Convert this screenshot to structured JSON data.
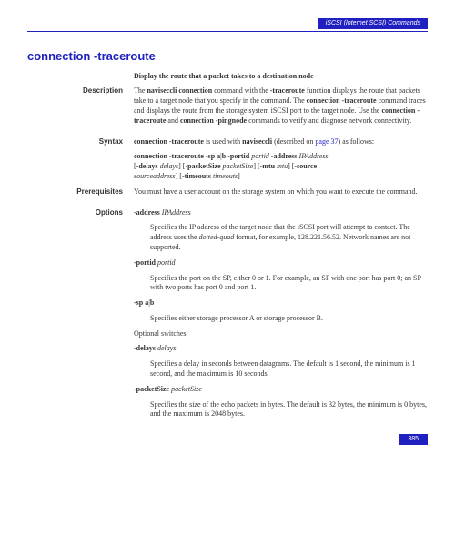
{
  "header": {
    "title": "iSCSI (Internet SCSI) Commands"
  },
  "section_title": "connection  -traceroute",
  "subtitle": "Display the route that a packet takes to a destination node",
  "description": {
    "label": "Description",
    "p1a": "The ",
    "p1b": "naviseccli connection",
    "p1c": " command with the ",
    "p1d": "-traceroute",
    "p1e": " function displays the route that packets take to a target node that you specify in the command. The ",
    "p1f": "connection -traceroute",
    "p1g": " command traces and displays the route from the storage system iSCSI port to the target node. Use the ",
    "p1h": "connection -traceroute",
    "p1i": " and ",
    "p1j": "connection -pingnode",
    "p1k": " commands to verify and diagnose network connectivity."
  },
  "syntax": {
    "label": "Syntax",
    "l1a": "connection  -traceroute",
    "l1b": " is used with ",
    "l1c": "naviseccli",
    "l1d": " (described on ",
    "l1e": "page 37",
    "l1f": ") as follows:",
    "l2a": "connection  -traceroute -sp a",
    "l2b": "|",
    "l2c": "b -portid",
    "l2d": " portid ",
    "l2e": "-address",
    "l2f": " IPAddress",
    "l3a": "[",
    "l3b": "-delays",
    "l3c": " delays",
    "l3d": "] [",
    "l3e": "-packetSize",
    "l3f": " packetSize",
    "l3g": "] [",
    "l3h": "-mtu",
    "l3i": " mtu",
    "l3j": "] [",
    "l3k": "-source",
    "l4a": "sourceaddress",
    "l4b": "] [",
    "l4c": "-timeouts",
    "l4d": " timeouts",
    "l4e": "]"
  },
  "prerequisites": {
    "label": "Prerequisites",
    "text": "You must have a user account on the storage system on which you want to execute the command."
  },
  "options": {
    "label": "Options",
    "opt1": {
      "flag": "-address",
      "arg": " IPAddress",
      "desc_a": "Specifies the IP address of the target node that the iSCSI port will attempt to contact. The address uses the ",
      "desc_b": "dotted-quad",
      "desc_c": " format, for example, 128.221.56.52. Network names are not supported."
    },
    "opt2": {
      "flag": "-portid",
      "arg": " portid",
      "desc": "Specifies the port on the SP, either 0 or 1. For example, an SP with one port has port 0; an SP with two ports has port 0 and port 1."
    },
    "opt3": {
      "flaga": "-sp a",
      "flagb": "|",
      "flagc": "b",
      "desc": "Specifies either storage processor A or storage processor B."
    },
    "optional_label": "Optional switches:",
    "opt4": {
      "flag": "-delays",
      "arg": " delays",
      "desc": "Specifies a delay in seconds between datagrams. The default is 1 second, the minimum is 1 second, and the maximum is 10 seconds."
    },
    "opt5": {
      "flag": "-packetSize",
      "arg": " packetSize",
      "desc": "Specifies the size of the echo packets in bytes. The default is 32 bytes, the minimum is 0 bytes, and the maximum is 2048 bytes."
    }
  },
  "footer": {
    "page": "385"
  }
}
